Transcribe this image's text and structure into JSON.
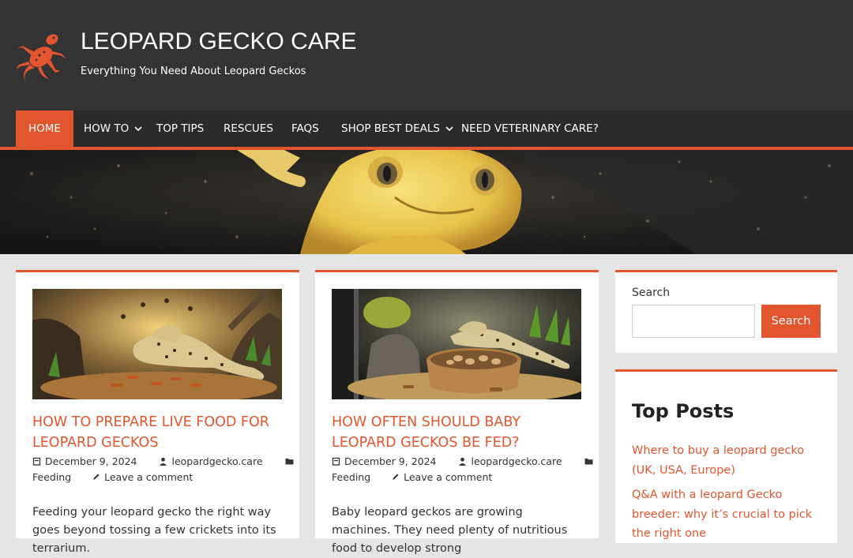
{
  "site": {
    "title": "LEOPARD GECKO CARE",
    "tagline": "Everything You Need About Leopard Geckos"
  },
  "nav": {
    "items": [
      {
        "label": "HOME",
        "active": true
      },
      {
        "label": "HOW TO",
        "dropdown": true
      },
      {
        "label": "TOP TIPS"
      },
      {
        "label": "RESCUES"
      },
      {
        "label": "FAQS"
      },
      {
        "label": "SHOP BEST DEALS",
        "dropdown": true
      },
      {
        "label": "NEED VETERINARY CARE?"
      }
    ]
  },
  "posts": [
    {
      "title": "HOW TO PREPARE LIVE FOOD FOR LEOPARD GECKOS",
      "date": "December 9, 2024",
      "author": "leopardgecko.care",
      "category": "Feeding",
      "comment": "Leave a comment",
      "excerpt": "Feeding your leopard gecko the right way goes beyond tossing a few crickets into its terrarium."
    },
    {
      "title": "HOW OFTEN SHOULD BABY LEOPARD GECKOS BE FED?",
      "date": "December 9, 2024",
      "author": "leopardgecko.care",
      "category": "Feeding",
      "comment": "Leave a comment",
      "excerpt": "Baby leopard geckos are growing machines. They need plenty of nutritious food to develop strong"
    }
  ],
  "sidebar": {
    "search": {
      "label": "Search",
      "button": "Search",
      "value": ""
    },
    "top_posts": {
      "title": "Top Posts",
      "links": [
        "Where to buy a leopard gecko (UK, USA, Europe)",
        "Q&A with a leopard Gecko breeder: why it’s crucial to pick the right one"
      ]
    }
  },
  "colors": {
    "accent": "#e2552e",
    "header_bg": "#333333",
    "nav_bg": "#2b2b2b",
    "page_bg": "#e5e5e5"
  }
}
